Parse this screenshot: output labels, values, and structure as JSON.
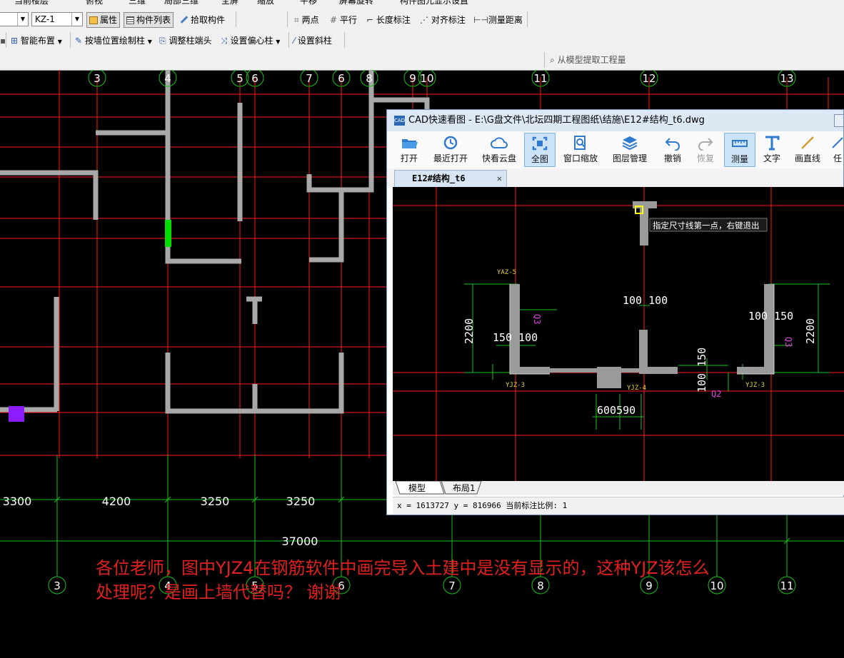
{
  "toolbar_top": {
    "cut_items": [
      "当前楼层",
      "俯视",
      "三维",
      "局部三维",
      "全屏",
      "缩放",
      "平移",
      "屏幕旋转",
      "构件图元显示设置"
    ]
  },
  "toolbar_row1": {
    "layer_select": "",
    "component_select": "KZ-1",
    "attr_label": "属性",
    "list_label": "构件列表",
    "pick_label": "拾取构件",
    "two_point": "两点",
    "parallel": "平行",
    "length_dim": "长度标注",
    "align_dim": "对齐标注",
    "measure_dist": "测量距离"
  },
  "toolbar_row2": {
    "smart_layout": "智能布置",
    "draw_by_wall": "按墙位置绘制柱",
    "adjust_col_end": "调整柱端头",
    "set_offset_col": "设置偏心柱",
    "set_slant_col": "设置斜柱"
  },
  "toolbar_row3": {
    "extract_qty": "从模型提取工程量"
  },
  "grid": {
    "top_axes": [
      "3",
      "4",
      "5",
      "6",
      "7",
      "6",
      "8",
      "9",
      "10",
      "11",
      "12",
      "13"
    ],
    "bottom_axes": [
      "3",
      "4",
      "5",
      "6",
      "7",
      "8",
      "9",
      "10",
      "11"
    ],
    "dimensions": [
      "3300",
      "4200",
      "3250",
      "3250"
    ],
    "total": "37000"
  },
  "annotation": {
    "line1": "各位老师，图中YJZ4在钢筋软件中画完导入土建中是没有显示的，这种YJZ该怎么",
    "line2": "处理呢？是画上墙代替吗？ 谢谢"
  },
  "cad_window": {
    "title": "CAD快速看图 - E:\\G盘文件\\北坛四期工程图纸\\结施\\E12#结构_t6.dwg",
    "app_icon": "CAD",
    "ribbon": [
      {
        "label": "打开",
        "icon": "folder-open-icon"
      },
      {
        "label": "最近打开",
        "icon": "recent-icon"
      },
      {
        "label": "快看云盘",
        "icon": "cloud-icon"
      },
      {
        "label": "全图",
        "icon": "fit-all-icon"
      },
      {
        "label": "窗口缩放",
        "icon": "zoom-window-icon"
      },
      {
        "label": "图层管理",
        "icon": "layers-icon"
      },
      {
        "label": "撤销",
        "icon": "undo-icon"
      },
      {
        "label": "恢复",
        "icon": "redo-icon"
      },
      {
        "label": "测量",
        "icon": "measure-icon"
      },
      {
        "label": "文字",
        "icon": "text-icon"
      },
      {
        "label": "画直线",
        "icon": "line-icon"
      },
      {
        "label": "任",
        "icon": "more-icon"
      }
    ],
    "doc_tab": "E12#结构_t6",
    "tooltip": "指定尺寸线第一点，右键退出",
    "labels": {
      "yaz5": "YAZ-5",
      "yjz3a": "YJZ-3",
      "yjz4": "YJZ-4",
      "yjz3b": "YJZ-3",
      "q3a": "Q3",
      "q3b": "Q3",
      "q2": "Q2",
      "d100_100": "100 100",
      "d150_100": "150 100",
      "d100_150a": "100 150",
      "d100_150v": "100 150",
      "d2200a": "2200",
      "d2200b": "2200",
      "d600_590": "600590"
    },
    "bottom_tabs": [
      "模型",
      "布局1"
    ],
    "status": "x = 1613727  y = 816966  当前标注比例: 1"
  }
}
